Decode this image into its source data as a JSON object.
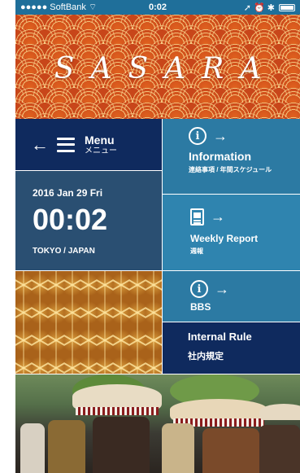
{
  "status_bar": {
    "carrier": "●●●●● SoftBank",
    "time": "0:02",
    "indicators": "➚ ⏰ ✱"
  },
  "banner": {
    "title": "SASARA"
  },
  "menu_tile": {
    "label_en": "Menu",
    "label_jp": "メニュー",
    "back_arrow": "←"
  },
  "clock_tile": {
    "date": "2016 Jan 29 Fri",
    "time": "00:02",
    "place": "TOKYO / JAPAN"
  },
  "info_tile": {
    "title": "Information",
    "subtitle": "連絡事項 / 年間スケジュール",
    "arrow": "→"
  },
  "weekly_tile": {
    "title": "Weekly Report",
    "subtitle": "週報",
    "arrow": "→"
  },
  "bbs_tile": {
    "title": "BBS",
    "arrow": "→"
  },
  "rule_tile": {
    "title": "Internal Rule",
    "subtitle": "社内規定"
  },
  "colors": {
    "navy": "#0f2a5e",
    "slate": "#2a4f72",
    "teal": "#2c7aa3",
    "banner_orange": "#d9541b"
  },
  "icons": [
    "info-icon",
    "document-icon",
    "hamburger-icon",
    "back-arrow-icon",
    "forward-arrow-icon"
  ]
}
